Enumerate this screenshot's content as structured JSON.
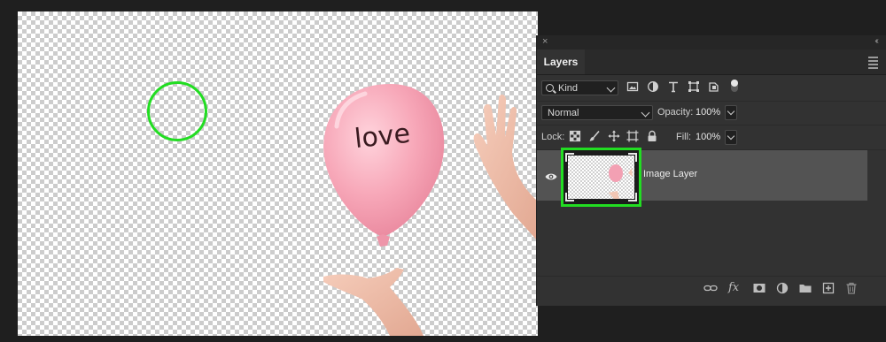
{
  "panel": {
    "close_glyph": "×",
    "collapse_glyph": "‹‹",
    "tab_label": "Layers"
  },
  "filter": {
    "kind_label": "Kind",
    "icons": [
      "image-filter-icon",
      "adjustment-filter-icon",
      "type-filter-icon",
      "shape-filter-icon",
      "smart-object-filter-icon"
    ]
  },
  "blend": {
    "mode": "Normal",
    "opacity_label": "Opacity:",
    "opacity_value": "100%"
  },
  "lock": {
    "label": "Lock:",
    "icons": [
      "lock-transparent-pixels-icon",
      "lock-image-pixels-icon",
      "lock-position-icon",
      "lock-artboard-icon",
      "lock-all-icon"
    ],
    "fill_label": "Fill:",
    "fill_value": "100%"
  },
  "layers": [
    {
      "name": "Image Layer",
      "visible": true,
      "selected": true
    }
  ],
  "canvas": {
    "balloon_text": "love",
    "balloon_color": "#f7a7b8",
    "cursor_color": "#22dd22"
  },
  "bottom_icons": [
    "link-layers-icon",
    "fx-icon",
    "add-mask-icon",
    "adjustment-layer-icon",
    "group-folder-icon",
    "new-layer-icon",
    "delete-icon"
  ],
  "fx_label": "fx"
}
